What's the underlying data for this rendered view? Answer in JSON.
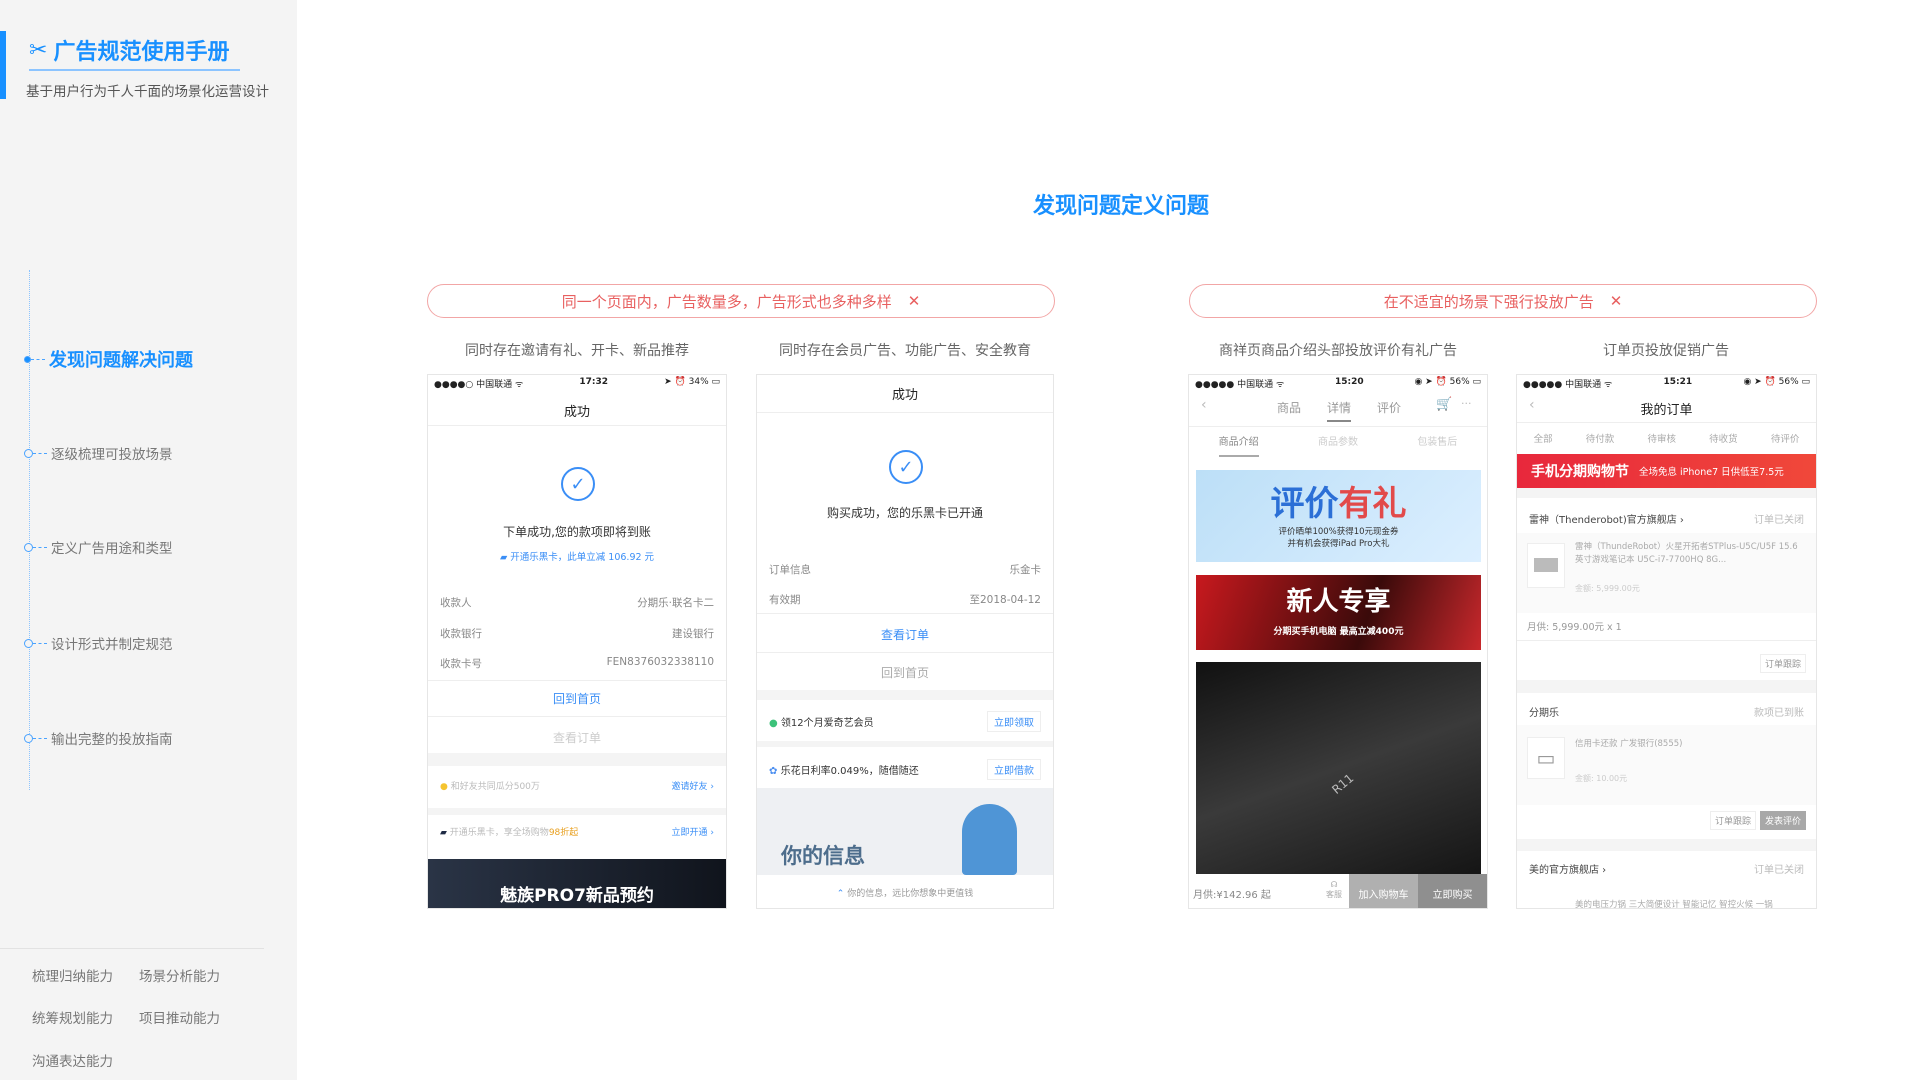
{
  "sidebar": {
    "brand": "广告规范使用手册",
    "subtitle": "基于用户行为千人千面的场景化运营设计",
    "nav": [
      "发现问题解决问题",
      "逐级梳理可投放场景",
      "定义广告用途和类型",
      "设计形式并制定规范",
      "输出完整的投放指南"
    ],
    "skills": [
      "梳理归纳能力",
      "场景分析能力",
      "统筹规划能力",
      "项目推动能力",
      "沟通表达能力"
    ]
  },
  "main": {
    "title": "发现问题定义问题",
    "problems": [
      "同一个页面内，广告数量多，广告形式也多种多样",
      "在不适宜的场景下强行投放广告"
    ],
    "close_glyph": "✕",
    "captions": [
      "同时存在邀请有礼、开卡、新品推荐",
      "同时存在会员广告、功能广告、安全教育",
      "商祥页商品介绍头部投放评价有礼广告",
      "订单页投放促销广告"
    ]
  },
  "phone1": {
    "carrier": "●●●●○ 中国联通 ᯤ",
    "time": "17:32",
    "battery": "➤ ⏰ 34% ▭",
    "title": "成功",
    "message": "下单成功,您的款项即将到账",
    "promo": "开通乐黑卡，此单立减 106.92 元",
    "rows": [
      [
        "收款人",
        "分期乐·联名卡二"
      ],
      [
        "收款银行",
        "建设银行"
      ],
      [
        "收款卡号",
        "FEN8376032338110"
      ]
    ],
    "primary": "回到首页",
    "secondary": "查看订单",
    "ads": [
      {
        "text": "和好友共同瓜分500万",
        "action": "邀请好友 ›"
      },
      {
        "text": "开通乐黑卡，享全场购物",
        "highlight": "98折起",
        "action": "立即开通 ›"
      }
    ],
    "banner": "魅族PRO7新品预约"
  },
  "phone2": {
    "title": "成功",
    "message": "购买成功，您的乐黑卡已开通",
    "rows": [
      [
        "订单信息",
        "乐金卡"
      ],
      [
        "有效期",
        "至2018-04-12"
      ]
    ],
    "primary": "查看订单",
    "secondary": "回到首页",
    "ads": [
      {
        "text": "领12个月爱奇艺会员",
        "action": "立即领取"
      },
      {
        "text": "乐花日利率0.049%，随借随还",
        "action": "立即借款"
      }
    ],
    "banner": "你的信息",
    "footer": "你的信息，远比你想象中更值钱"
  },
  "phone3": {
    "carrier": "●●●●● 中国联通 ᯤ",
    "time": "15:20",
    "battery": "◉ ➤ ⏰ 56% ▭",
    "tabs": [
      "商品",
      "详情",
      "评价"
    ],
    "subtabs": [
      "商品介绍",
      "商品参数",
      "包装售后"
    ],
    "banner1": {
      "title_a": "评价",
      "title_b": "有礼",
      "line1": "评价晒单100%获得10元现金券",
      "line2": "并有机会获得iPad Pro大礼"
    },
    "banner2": {
      "title": "新人专享",
      "line": "分期买手机电脑  最高立减400元"
    },
    "product_text": "R11",
    "bottom": {
      "price": "月供:¥142.96 起",
      "service": "客服",
      "cart": "加入购物车",
      "buy": "立即购买"
    }
  },
  "phone4": {
    "carrier": "●●●●● 中国联通 ᯤ",
    "time": "15:21",
    "battery": "◉ ➤ ⏰ 56% ▭",
    "title": "我的订单",
    "tabs": [
      "全部",
      "待付款",
      "待审核",
      "待收货",
      "待评价"
    ],
    "banner": {
      "title": "手机分期购物节",
      "sub": "全场免息 iPhone7 日供低至7.5元"
    },
    "orders": [
      {
        "store": "雷神（Thenderobot)官方旗舰店 ›",
        "status": "订单已关闭",
        "item": "雷神（ThundeRobot）火星开拓者STPlus-U5C/U5F 15.6英寸游戏笔记本 U5C-i7-7700HQ 8G...",
        "amount": "金额: 5,999.00元",
        "monthly": "月供: 5,999.00元 x 1",
        "buttons": [
          "订单跟踪"
        ]
      },
      {
        "store": "分期乐",
        "status": "款项已到账",
        "item": "信用卡还款 广发银行(8555)",
        "amount": "金额: 10.00元",
        "buttons": [
          "订单跟踪",
          "发表评价"
        ]
      },
      {
        "store": "美的官方旗舰店 ›",
        "status": "订单已关闭",
        "item": "美的电压力锅 三大简便设计 智能记忆 智控火候 一锅"
      }
    ]
  }
}
